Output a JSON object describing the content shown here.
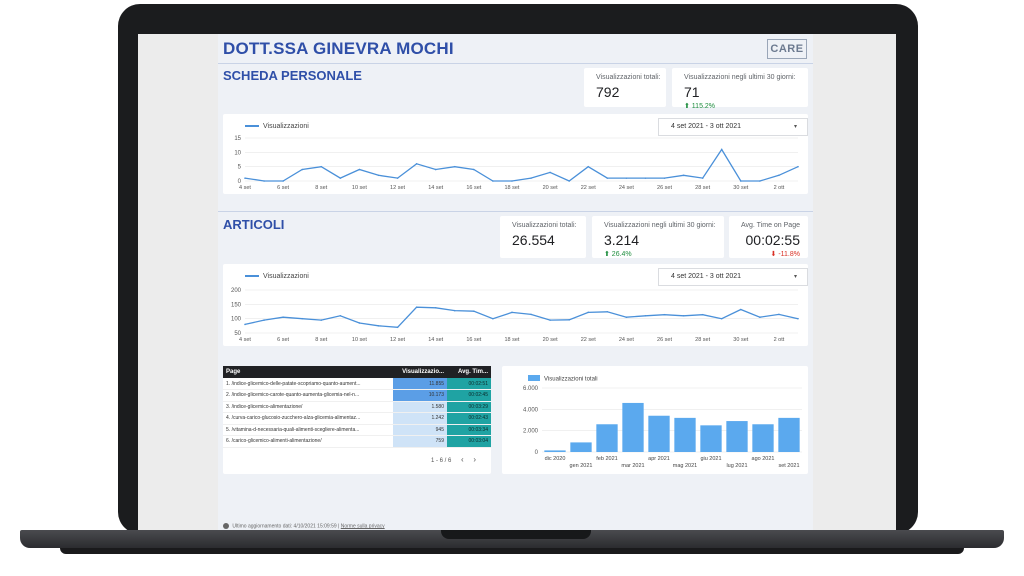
{
  "report": {
    "title": "DOTT.SSA GINEVRA MOCHI",
    "logo_text": "CARE"
  },
  "personal": {
    "section_title": "SCHEDA PERSONALE",
    "kpi_total": {
      "label": "Visualizzazioni totali:",
      "value": "792"
    },
    "kpi_30d": {
      "label": "Visualizzazioni negli ultimi 30 giorni:",
      "value": "71",
      "delta": "⬆ 115.2%"
    },
    "chart": {
      "legend": "Visualizzazioni",
      "date_range": "4 set 2021 - 3 ott 2021",
      "dropdown_icon": "▾"
    }
  },
  "articles": {
    "section_title": "ARTICOLI",
    "kpi_total": {
      "label": "Visualizzazioni totali:",
      "value": "26.554"
    },
    "kpi_30d": {
      "label": "Visualizzazioni negli ultimi 30 giorni:",
      "value": "3.214",
      "delta": "⬆ 26.4%"
    },
    "kpi_time": {
      "label": "Avg. Time on Page",
      "value": "00:02:55",
      "delta": "⬇ -11.8%"
    },
    "chart": {
      "legend": "Visualizzazioni",
      "date_range": "4 set 2021 - 3 ott 2021",
      "dropdown_icon": "▾"
    },
    "table": {
      "headers": [
        "Page",
        "Visualizzazio...",
        "Avg. Tim..."
      ],
      "rows": [
        {
          "n": "1.",
          "page": "/indice-glicemico-delle-patate-scopriamo-quanto-aument...",
          "views": "11.855",
          "time": "00:02:51"
        },
        {
          "n": "2.",
          "page": "/indice-glicemico-carote-quanto-aumenta-glicemia-nel-n...",
          "views": "10.173",
          "time": "00:02:45"
        },
        {
          "n": "3.",
          "page": "/indice-glicemico-alimentazione/",
          "views": "1.580",
          "time": "00:03:29"
        },
        {
          "n": "4.",
          "page": "/curva-carico-glucosio-zucchero-alza-glicemia-alimentaz...",
          "views": "1.242",
          "time": "00:02:43"
        },
        {
          "n": "5.",
          "page": "/vitamina-d-necessaria-quali-alimenti-scegliere-alimenta...",
          "views": "945",
          "time": "00:03:34"
        },
        {
          "n": "6.",
          "page": "/carico-glicemico-alimenti-alimentazione/",
          "views": "759",
          "time": "00:03:04"
        }
      ],
      "pager": "1 - 6 / 6",
      "prev_icon": "‹",
      "next_icon": "›"
    }
  },
  "footer": {
    "updated": "Ultimo aggiornamento dati: 4/10/2021 15:09:59",
    "separator": "|",
    "privacy": "Norme sulla privacy"
  },
  "chart_data": [
    {
      "type": "line",
      "title": "",
      "series": [
        {
          "name": "Visualizzazioni",
          "values": [
            1,
            0,
            0,
            4,
            5,
            1,
            4,
            2,
            1,
            6,
            4,
            5,
            4,
            0,
            0,
            1,
            3,
            0,
            5,
            1,
            1,
            1,
            1,
            2,
            1,
            11,
            0,
            0,
            2,
            5
          ]
        }
      ],
      "x_ticks": [
        "4 set",
        "6 set",
        "8 set",
        "10 set",
        "12 set",
        "14 set",
        "16 set",
        "18 set",
        "20 set",
        "22 set",
        "24 set",
        "26 set",
        "28 set",
        "30 set",
        "2 ott"
      ],
      "y_ticks": [
        0,
        5,
        10,
        15
      ],
      "ylim": [
        0,
        15
      ],
      "grid": true,
      "legend": "top-left"
    },
    {
      "type": "line",
      "title": "",
      "series": [
        {
          "name": "Visualizzazioni",
          "values": [
            80,
            95,
            105,
            100,
            95,
            110,
            85,
            75,
            70,
            140,
            138,
            128,
            126,
            100,
            122,
            115,
            95,
            96,
            122,
            124,
            105,
            110,
            114,
            110,
            114,
            100,
            132,
            105,
            115,
            100
          ]
        }
      ],
      "x_ticks": [
        "4 set",
        "6 set",
        "8 set",
        "10 set",
        "12 set",
        "14 set",
        "16 set",
        "18 set",
        "20 set",
        "22 set",
        "24 set",
        "26 set",
        "28 set",
        "30 set",
        "2 ott"
      ],
      "y_ticks": [
        50,
        100,
        150,
        200
      ],
      "ylim": [
        50,
        200
      ],
      "grid": true,
      "legend": "top-left"
    },
    {
      "type": "bar",
      "title": "",
      "series": [
        {
          "name": "Visualizzazioni totali",
          "values": [
            150,
            900,
            2600,
            4600,
            3400,
            3200,
            2500,
            2900,
            2600,
            3200
          ]
        }
      ],
      "categories": [
        "dic 2020",
        "gen 2021",
        "feb 2021",
        "mar 2021",
        "apr 2021",
        "mag 2021",
        "giu 2021",
        "lug 2021",
        "ago 2021",
        "set 2021"
      ],
      "y_ticks": [
        "0",
        "2.000",
        "4.000",
        "6.000"
      ],
      "ylim": [
        0,
        6000
      ],
      "grid": true,
      "legend": "top-left"
    }
  ]
}
